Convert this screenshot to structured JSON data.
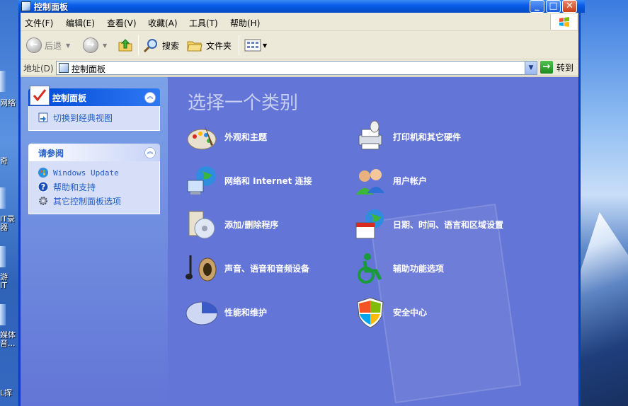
{
  "desktop": {
    "left_labels": [
      "网络",
      "奇",
      "IT录",
      "器",
      "游",
      "IT",
      "媒体",
      "音...",
      "L挥"
    ]
  },
  "window": {
    "title": "控制面板",
    "buttons": {
      "minimize": "_",
      "maximize": "□",
      "close": "✕"
    }
  },
  "menu": {
    "items": [
      "文件(F)",
      "编辑(E)",
      "查看(V)",
      "收藏(A)",
      "工具(T)",
      "帮助(H)"
    ]
  },
  "toolbar": {
    "back_label": "后退",
    "search_label": "搜索",
    "folders_label": "文件夹"
  },
  "address": {
    "label": "地址(D)",
    "value": "控制面板",
    "go_label": "转到"
  },
  "taskpane": {
    "panel1": {
      "title": "控制面板",
      "links": [
        "切换到经典视图"
      ]
    },
    "panel2": {
      "title": "请参阅",
      "links": [
        "Windows Update",
        "帮助和支持",
        "其它控制面板选项"
      ]
    }
  },
  "main": {
    "heading": "选择一个类别",
    "categories": [
      {
        "label": "外观和主题",
        "icon": "appearance-icon"
      },
      {
        "label": "打印机和其它硬件",
        "icon": "printer-icon"
      },
      {
        "label": "网络和 Internet 连接",
        "icon": "network-icon"
      },
      {
        "label": "用户帐户",
        "icon": "users-icon"
      },
      {
        "label": "添加/删除程序",
        "icon": "add-remove-icon"
      },
      {
        "label": "日期、时间、语言和区域设置",
        "icon": "datetime-icon"
      },
      {
        "label": "声音、语音和音频设备",
        "icon": "sound-icon"
      },
      {
        "label": "辅助功能选项",
        "icon": "accessibility-icon"
      },
      {
        "label": "性能和维护",
        "icon": "performance-icon"
      },
      {
        "label": "安全中心",
        "icon": "security-shield-icon"
      }
    ]
  },
  "colors": {
    "titlebar": "#0453d8",
    "content_bg": "#6375d6",
    "link": "#215dc6"
  }
}
